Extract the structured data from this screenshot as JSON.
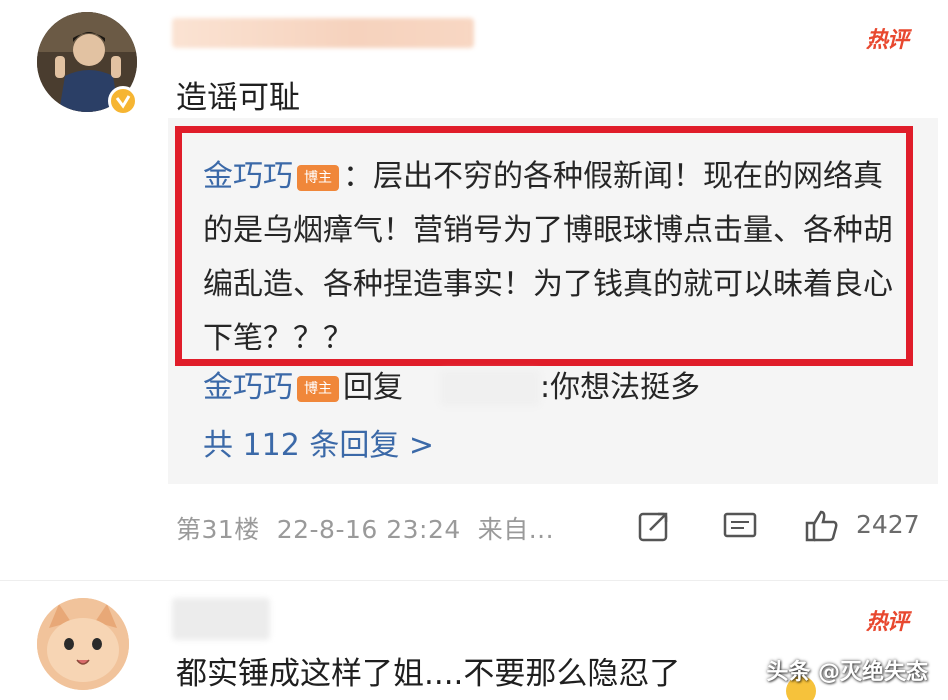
{
  "comment_1": {
    "hot_label": "热评",
    "text": "造谣可耻"
  },
  "quoted_reply": {
    "author": "金巧巧",
    "badge": "博主",
    "text": "：层出不穷的各种假新闻！现在的网络真的是乌烟瘴气！营销号为了博眼球博点击量、各种胡编乱造、各种捏造事实！为了钱真的就可以昧着良心下笔？？？"
  },
  "second_reply": {
    "author": "金巧巧",
    "badge": "博主",
    "action": "回复",
    "text": ":你想法挺多"
  },
  "more_replies": "共 112 条回复 >",
  "meta": {
    "floor": "第31楼",
    "datetime": "22-8-16 23:24",
    "source": "来自..."
  },
  "actions": {
    "share_icon": "share-icon",
    "comment_icon": "comment-icon",
    "like_icon": "thumbs-up-icon",
    "like_count": "2427"
  },
  "comment_2": {
    "hot_label": "热评",
    "text": "都实锤成这样了姐....不要那么隐忍了"
  },
  "watermark": "头条 @灭绝失态",
  "colors": {
    "highlight_border": "#e01d2a",
    "link_blue": "#3b69a8",
    "hot_red": "#e8482f",
    "badge_orange": "#f0873a"
  }
}
